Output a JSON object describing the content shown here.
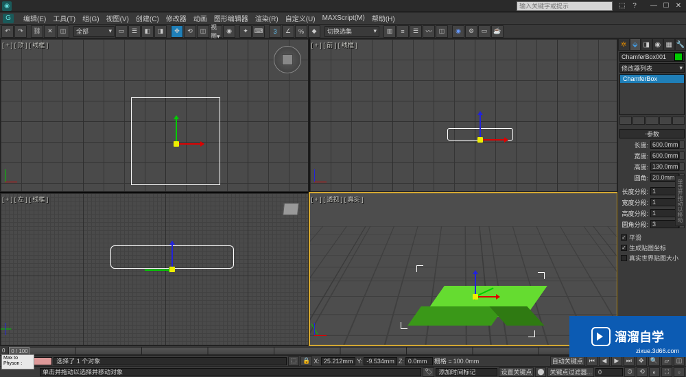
{
  "titlebar": {
    "search_placeholder": "输入关键字或提示",
    "min": "—",
    "max": "☐",
    "close": "✕"
  },
  "menu": [
    "编辑(E)",
    "工具(T)",
    "组(G)",
    "视图(V)",
    "创建(C)",
    "修改器",
    "动画",
    "图形编辑器",
    "渲染(R)",
    "自定义(U)",
    "MAXScript(M)",
    "帮助(H)"
  ],
  "toolbar": {
    "scope_dd": "全部",
    "filter_dd": "切换选集"
  },
  "viewports": {
    "tl": {
      "label": "[ + ] [ 顶 ] [ 线框 ]"
    },
    "tr": {
      "label": "[ + ] [ 前 ] [ 线框 ]"
    },
    "bl": {
      "label": "[ + ] [ 左 ] [ 线框 ]"
    },
    "br": {
      "label": "[ + ] [ 透视 ] [ 真实 ]"
    }
  },
  "panel": {
    "objname": "ChamferBox001",
    "modlist_dd": "修改器列表",
    "stack_item": "ChamferBox",
    "rollout": "参数",
    "params": [
      {
        "label": "长度:",
        "value": "600.0mm"
      },
      {
        "label": "宽度:",
        "value": "600.0mm"
      },
      {
        "label": "高度:",
        "value": "130.0mm"
      },
      {
        "label": "圆角:",
        "value": "20.0mm"
      }
    ],
    "segs": [
      {
        "label": "长度分段:",
        "value": "1"
      },
      {
        "label": "宽度分段:",
        "value": "1"
      },
      {
        "label": "高度分段:",
        "value": "1"
      },
      {
        "label": "圆角分段:",
        "value": "3"
      }
    ],
    "chks": [
      {
        "label": "平滑",
        "checked": true
      },
      {
        "label": "生成贴图坐标",
        "checked": true
      },
      {
        "label": "真实世界贴图大小",
        "checked": false
      }
    ],
    "scroll_hint": "单击并拖动以移动"
  },
  "timeline": {
    "knob": "0 / 100",
    "start": "0",
    "end": "100"
  },
  "status": {
    "sel": "选择了 1 个对象",
    "hint": "单击并拖动以选择并移动对象",
    "x_lbl": "X:",
    "x": "25.212mm",
    "y_lbl": "Y:",
    "y": "-9.534mm",
    "z_lbl": "Z:",
    "z": "0.0mm",
    "grid_lbl": "栅格 =",
    "grid": "100.0mm",
    "autokey": "自动关键点",
    "setkey": "设置关键点",
    "keyfilter": "关键点过滤器...",
    "addtime": "添加时间标记",
    "maxscript": "Max to Physon :"
  }
}
